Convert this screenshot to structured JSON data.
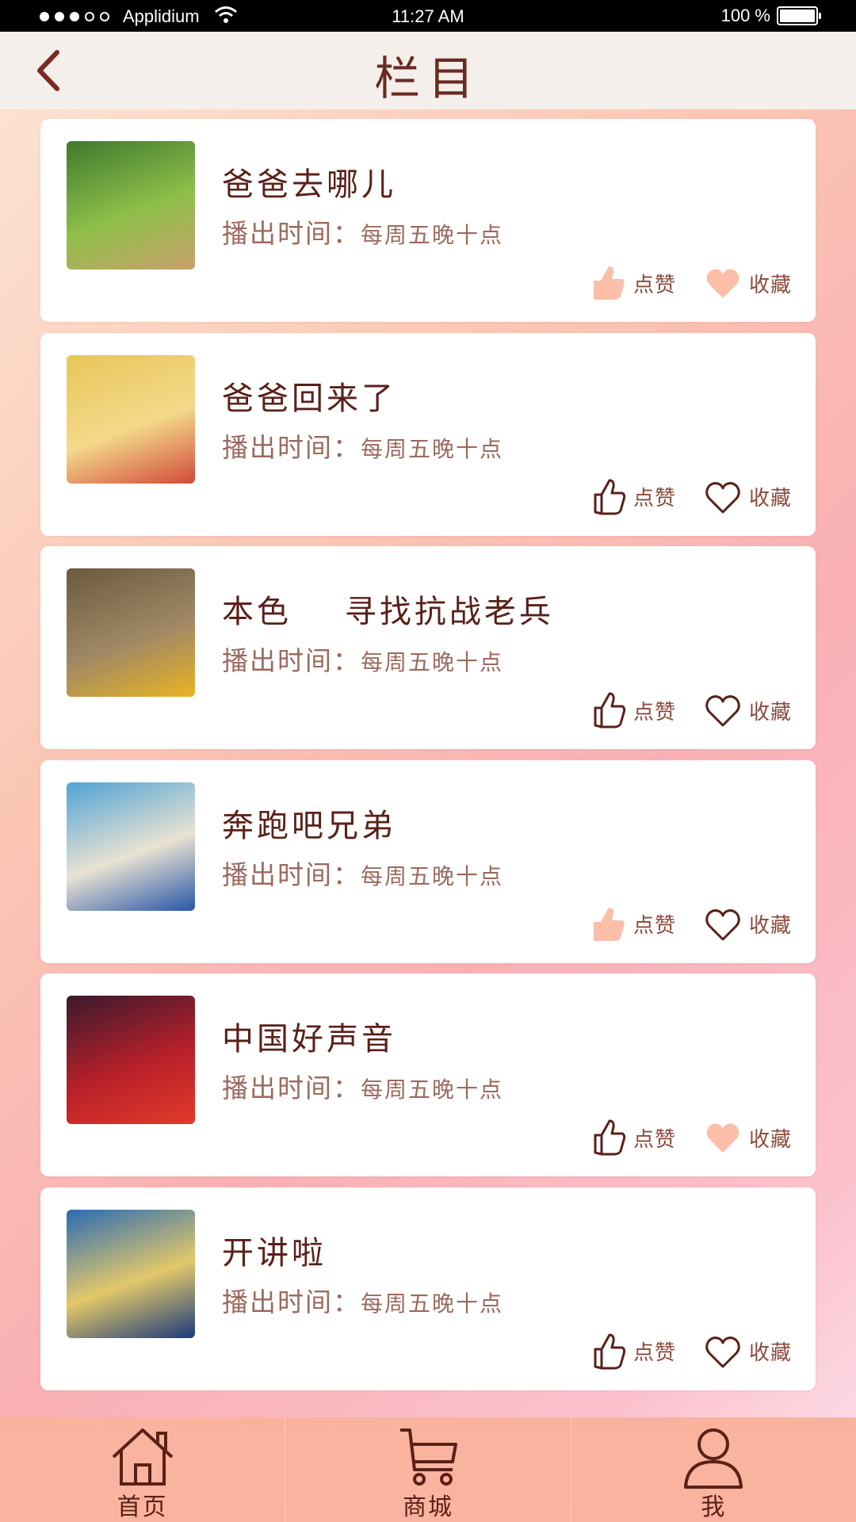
{
  "status_bar": {
    "carrier": "Applidium",
    "time": "11:27 AM",
    "battery": "100 %"
  },
  "header": {
    "title": "栏目"
  },
  "programs": [
    {
      "title": "爸爸去哪儿",
      "time_label": "播出时间：",
      "time_value": "每周五晚十点",
      "like_label": "点赞",
      "fav_label": "收藏",
      "liked": true,
      "favorited": true,
      "thumb_colors": [
        "#3e7a2e",
        "#8fbf4a",
        "#c9a06a"
      ]
    },
    {
      "title": "爸爸回来了",
      "time_label": "播出时间：",
      "time_value": "每周五晚十点",
      "like_label": "点赞",
      "fav_label": "收藏",
      "liked": false,
      "favorited": false,
      "thumb_colors": [
        "#e8c65a",
        "#f4d98a",
        "#d14a3a"
      ]
    },
    {
      "title": "本色    寻找抗战老兵",
      "time_label": "播出时间：",
      "time_value": "每周五晚十点",
      "like_label": "点赞",
      "fav_label": "收藏",
      "liked": false,
      "favorited": false,
      "thumb_colors": [
        "#6b5a3e",
        "#a08866",
        "#e8b323"
      ]
    },
    {
      "title": "奔跑吧兄弟",
      "time_label": "播出时间：",
      "time_value": "每周五晚十点",
      "like_label": "点赞",
      "fav_label": "收藏",
      "liked": true,
      "favorited": false,
      "thumb_colors": [
        "#4fa3d6",
        "#e9e2d2",
        "#2856a8"
      ]
    },
    {
      "title": "中国好声音",
      "time_label": "播出时间：",
      "time_value": "每周五晚十点",
      "like_label": "点赞",
      "fav_label": "收藏",
      "liked": false,
      "favorited": true,
      "thumb_colors": [
        "#3a1a2e",
        "#b8202a",
        "#e23a2a"
      ]
    },
    {
      "title": "开讲啦",
      "time_label": "播出时间：",
      "time_value": "每周五晚十点",
      "like_label": "点赞",
      "fav_label": "收藏",
      "liked": false,
      "favorited": false,
      "thumb_colors": [
        "#2a6bb4",
        "#e3c86a",
        "#1a3a7a"
      ]
    }
  ],
  "tabbar": {
    "items": [
      {
        "label": "首页",
        "icon": "home-icon"
      },
      {
        "label": "商城",
        "icon": "cart-icon"
      },
      {
        "label": "我",
        "icon": "user-icon"
      }
    ]
  },
  "colors": {
    "accent_filled": "#fbbfa9",
    "outline": "#5a2018",
    "title_text": "#6a2a22"
  }
}
